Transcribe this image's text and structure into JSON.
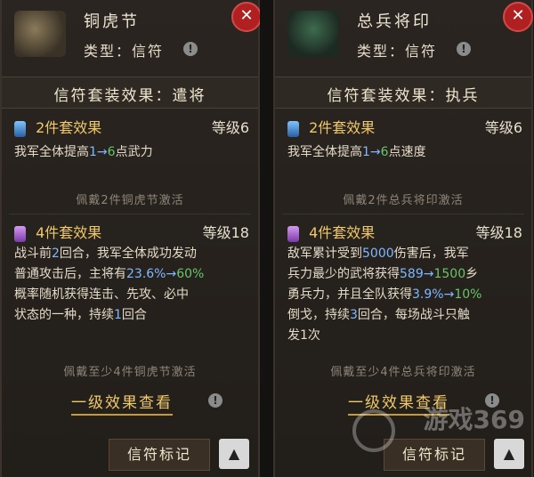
{
  "left": {
    "item_name": "铜虎节",
    "type_text": "类型：信符",
    "set_effect_title": "信符套装效果：遣将",
    "tier2": {
      "label": "2件套效果",
      "level": "等级6",
      "desc_a": "我军全体提高",
      "from": "1",
      "arrow": "→",
      "to": "6",
      "desc_b": "点武力",
      "hint": "佩戴2件铜虎节激活"
    },
    "tier4": {
      "label": "4件套效果",
      "level": "等级18",
      "l1a": "战斗前",
      "l1n": "2",
      "l1b": "回合，我军全体成功发动",
      "l2a": "普通攻击后，主将有",
      "p_from": "23.6%",
      "p_arrow": "→",
      "p_to": "60%",
      "l3": "概率随机获得连击、先攻、必中",
      "l4a": "状态的一种，持续",
      "l4n": "1",
      "l4b": "回合",
      "hint": "佩戴至少4件铜虎节激活"
    },
    "level1_link": "一级效果查看",
    "mark_button": "信符标记"
  },
  "right": {
    "item_name": "总兵将印",
    "type_text": "类型：信符",
    "set_effect_title": "信符套装效果：执兵",
    "tier2": {
      "label": "2件套效果",
      "level": "等级6",
      "desc_a": "我军全体提高",
      "from": "1",
      "arrow": "→",
      "to": "6",
      "desc_b": "点速度",
      "hint": "佩戴2件总兵将印激活"
    },
    "tier4": {
      "label": "4件套效果",
      "level": "等级18",
      "l1a": "敌军累计受到",
      "l1n": "5000",
      "l1b": "伤害后，我军",
      "l2a": "兵力最少的武将获得",
      "n_from": "589",
      "n_arrow": "→",
      "n_to": "1500",
      "l2b": "乡",
      "l3a": "勇兵力，并且全队获得",
      "p_from": "3.9%",
      "p_arrow": "→",
      "p_to": "10%",
      "l4a": "倒戈，持续",
      "l4n": "3",
      "l4b": "回合，每场战斗只触",
      "l5": "发1次",
      "hint": "佩戴至少4件总兵将印激活"
    },
    "level1_link": "一级效果查看",
    "mark_button": "信符标记"
  },
  "watermark": "游戏369"
}
